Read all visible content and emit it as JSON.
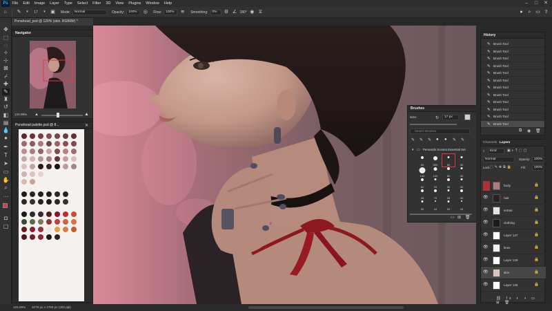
{
  "menubar": {
    "items": [
      "File",
      "Edit",
      "Image",
      "Layer",
      "Type",
      "Select",
      "Filter",
      "3D",
      "View",
      "Plugins",
      "Window",
      "Help"
    ]
  },
  "options": {
    "mode_label": "Mode:",
    "mode_value": "Normal",
    "opacity_label": "Opacity:",
    "opacity_value": "100%",
    "flow_label": "Flow:",
    "flow_value": "100%",
    "smoothing_label": "Smoothing:",
    "smoothing_value": "0%",
    "angle_value": "180°",
    "brush_size": "17"
  },
  "document": {
    "tab_title": "Ponahead_psd @ 120% (skin, RGB/8#) *",
    "zoom": "125.99%",
    "doc_info": "3279 px x 4759 px (300 ppi)"
  },
  "navigator": {
    "title": "Navigator",
    "zoom": "120.99%"
  },
  "swatch_doc": {
    "title": "Ponahead palette.psd @ 8..."
  },
  "brushes": {
    "title": "Brushes",
    "size_label": "Size:",
    "size_value": "17 px",
    "search_placeholder": "Search Brushes",
    "folder_name": "Pernande Scenes Essential Set",
    "cells": [
      {
        "num": "60"
      },
      {
        "num": "500"
      },
      {
        "num": "60"
      },
      {
        "num": "30"
      },
      {
        "num": "140"
      },
      {
        "num": "100"
      },
      {
        "num": "80"
      },
      {
        "num": "40"
      },
      {
        "num": "62"
      },
      {
        "num": "25"
      },
      {
        "num": "30"
      },
      {
        "num": "30"
      },
      {
        "num": "45"
      },
      {
        "num": "70"
      },
      {
        "num": "25"
      },
      {
        "num": "40"
      },
      {
        "num": "30"
      },
      {
        "num": "10"
      },
      {
        "num": "20"
      },
      {
        "num": "15"
      }
    ]
  },
  "history": {
    "title": "History",
    "items": [
      "Brush Tool",
      "Brush Tool",
      "Brush Tool",
      "Brush Tool",
      "Brush Tool",
      "Brush Tool",
      "Brush Tool",
      "Brush Tool",
      "Brush Tool",
      "Brush Tool",
      "Brush Tool",
      "Brush Tool"
    ]
  },
  "layers_panel": {
    "tab_channels": "Channels",
    "tab_layers": "Layers",
    "kind_label": "Kind",
    "blend_mode": "Normal",
    "opacity_label": "Opacity:",
    "opacity_value": "100%",
    "lock_label": "Lock:",
    "fill_label": "Fill:",
    "fill_value": "100%",
    "layers": [
      {
        "name": "body"
      },
      {
        "name": "hair"
      },
      {
        "name": "extras"
      },
      {
        "name": "clothing"
      },
      {
        "name": "Layer 127"
      },
      {
        "name": "lines"
      },
      {
        "name": "Layer 126"
      },
      {
        "name": "skin"
      },
      {
        "name": "Layer 128"
      }
    ]
  },
  "colors": {
    "accent": "#31a8ff",
    "foreground": "#e0393d",
    "background": "#2a2a2a"
  }
}
